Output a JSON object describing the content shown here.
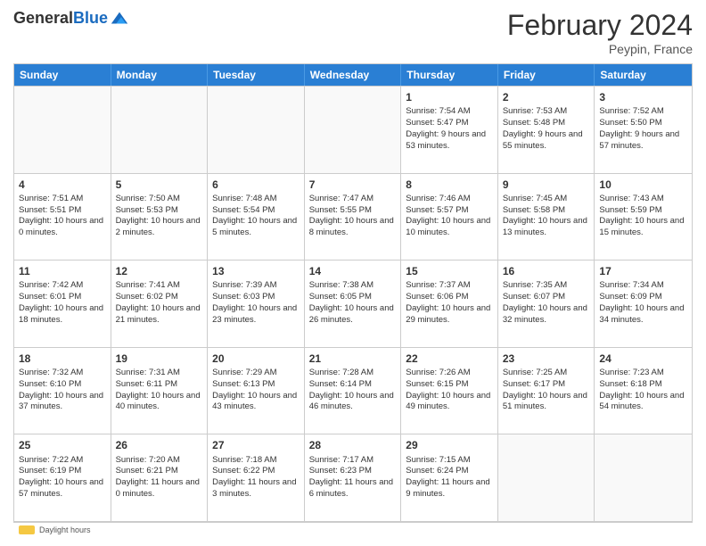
{
  "header": {
    "logo_general": "General",
    "logo_blue": "Blue",
    "month_year": "February 2024",
    "location": "Peypin, France"
  },
  "days_of_week": [
    "Sunday",
    "Monday",
    "Tuesday",
    "Wednesday",
    "Thursday",
    "Friday",
    "Saturday"
  ],
  "rows": [
    [
      {
        "day": "",
        "empty": true
      },
      {
        "day": "",
        "empty": true
      },
      {
        "day": "",
        "empty": true
      },
      {
        "day": "",
        "empty": true
      },
      {
        "day": "1",
        "sunrise": "Sunrise: 7:54 AM",
        "sunset": "Sunset: 5:47 PM",
        "daylight": "Daylight: 9 hours and 53 minutes."
      },
      {
        "day": "2",
        "sunrise": "Sunrise: 7:53 AM",
        "sunset": "Sunset: 5:48 PM",
        "daylight": "Daylight: 9 hours and 55 minutes."
      },
      {
        "day": "3",
        "sunrise": "Sunrise: 7:52 AM",
        "sunset": "Sunset: 5:50 PM",
        "daylight": "Daylight: 9 hours and 57 minutes."
      }
    ],
    [
      {
        "day": "4",
        "sunrise": "Sunrise: 7:51 AM",
        "sunset": "Sunset: 5:51 PM",
        "daylight": "Daylight: 10 hours and 0 minutes."
      },
      {
        "day": "5",
        "sunrise": "Sunrise: 7:50 AM",
        "sunset": "Sunset: 5:53 PM",
        "daylight": "Daylight: 10 hours and 2 minutes."
      },
      {
        "day": "6",
        "sunrise": "Sunrise: 7:48 AM",
        "sunset": "Sunset: 5:54 PM",
        "daylight": "Daylight: 10 hours and 5 minutes."
      },
      {
        "day": "7",
        "sunrise": "Sunrise: 7:47 AM",
        "sunset": "Sunset: 5:55 PM",
        "daylight": "Daylight: 10 hours and 8 minutes."
      },
      {
        "day": "8",
        "sunrise": "Sunrise: 7:46 AM",
        "sunset": "Sunset: 5:57 PM",
        "daylight": "Daylight: 10 hours and 10 minutes."
      },
      {
        "day": "9",
        "sunrise": "Sunrise: 7:45 AM",
        "sunset": "Sunset: 5:58 PM",
        "daylight": "Daylight: 10 hours and 13 minutes."
      },
      {
        "day": "10",
        "sunrise": "Sunrise: 7:43 AM",
        "sunset": "Sunset: 5:59 PM",
        "daylight": "Daylight: 10 hours and 15 minutes."
      }
    ],
    [
      {
        "day": "11",
        "sunrise": "Sunrise: 7:42 AM",
        "sunset": "Sunset: 6:01 PM",
        "daylight": "Daylight: 10 hours and 18 minutes."
      },
      {
        "day": "12",
        "sunrise": "Sunrise: 7:41 AM",
        "sunset": "Sunset: 6:02 PM",
        "daylight": "Daylight: 10 hours and 21 minutes."
      },
      {
        "day": "13",
        "sunrise": "Sunrise: 7:39 AM",
        "sunset": "Sunset: 6:03 PM",
        "daylight": "Daylight: 10 hours and 23 minutes."
      },
      {
        "day": "14",
        "sunrise": "Sunrise: 7:38 AM",
        "sunset": "Sunset: 6:05 PM",
        "daylight": "Daylight: 10 hours and 26 minutes."
      },
      {
        "day": "15",
        "sunrise": "Sunrise: 7:37 AM",
        "sunset": "Sunset: 6:06 PM",
        "daylight": "Daylight: 10 hours and 29 minutes."
      },
      {
        "day": "16",
        "sunrise": "Sunrise: 7:35 AM",
        "sunset": "Sunset: 6:07 PM",
        "daylight": "Daylight: 10 hours and 32 minutes."
      },
      {
        "day": "17",
        "sunrise": "Sunrise: 7:34 AM",
        "sunset": "Sunset: 6:09 PM",
        "daylight": "Daylight: 10 hours and 34 minutes."
      }
    ],
    [
      {
        "day": "18",
        "sunrise": "Sunrise: 7:32 AM",
        "sunset": "Sunset: 6:10 PM",
        "daylight": "Daylight: 10 hours and 37 minutes."
      },
      {
        "day": "19",
        "sunrise": "Sunrise: 7:31 AM",
        "sunset": "Sunset: 6:11 PM",
        "daylight": "Daylight: 10 hours and 40 minutes."
      },
      {
        "day": "20",
        "sunrise": "Sunrise: 7:29 AM",
        "sunset": "Sunset: 6:13 PM",
        "daylight": "Daylight: 10 hours and 43 minutes."
      },
      {
        "day": "21",
        "sunrise": "Sunrise: 7:28 AM",
        "sunset": "Sunset: 6:14 PM",
        "daylight": "Daylight: 10 hours and 46 minutes."
      },
      {
        "day": "22",
        "sunrise": "Sunrise: 7:26 AM",
        "sunset": "Sunset: 6:15 PM",
        "daylight": "Daylight: 10 hours and 49 minutes."
      },
      {
        "day": "23",
        "sunrise": "Sunrise: 7:25 AM",
        "sunset": "Sunset: 6:17 PM",
        "daylight": "Daylight: 10 hours and 51 minutes."
      },
      {
        "day": "24",
        "sunrise": "Sunrise: 7:23 AM",
        "sunset": "Sunset: 6:18 PM",
        "daylight": "Daylight: 10 hours and 54 minutes."
      }
    ],
    [
      {
        "day": "25",
        "sunrise": "Sunrise: 7:22 AM",
        "sunset": "Sunset: 6:19 PM",
        "daylight": "Daylight: 10 hours and 57 minutes."
      },
      {
        "day": "26",
        "sunrise": "Sunrise: 7:20 AM",
        "sunset": "Sunset: 6:21 PM",
        "daylight": "Daylight: 11 hours and 0 minutes."
      },
      {
        "day": "27",
        "sunrise": "Sunrise: 7:18 AM",
        "sunset": "Sunset: 6:22 PM",
        "daylight": "Daylight: 11 hours and 3 minutes."
      },
      {
        "day": "28",
        "sunrise": "Sunrise: 7:17 AM",
        "sunset": "Sunset: 6:23 PM",
        "daylight": "Daylight: 11 hours and 6 minutes."
      },
      {
        "day": "29",
        "sunrise": "Sunrise: 7:15 AM",
        "sunset": "Sunset: 6:24 PM",
        "daylight": "Daylight: 11 hours and 9 minutes."
      },
      {
        "day": "",
        "empty": true
      },
      {
        "day": "",
        "empty": true
      }
    ]
  ],
  "footer": {
    "daylight_label": "Daylight hours"
  }
}
